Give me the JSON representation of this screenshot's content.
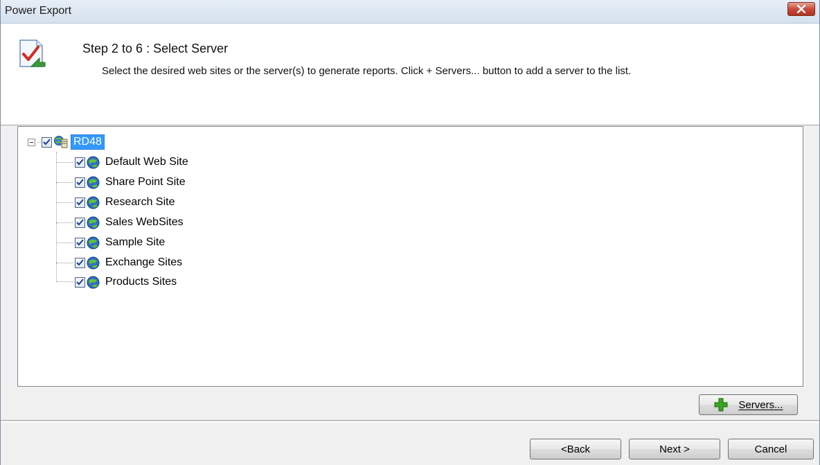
{
  "window": {
    "title": "Power Export"
  },
  "header": {
    "step_title": "Step 2 to 6 : Select Server",
    "description": "Select the desired web sites or the server(s) to generate reports. Click + Servers... button to add a server to the list.",
    "icon": "report-check-icon"
  },
  "tree": {
    "server": {
      "label": "RD48",
      "checked": true,
      "expanded": true
    },
    "sites": [
      {
        "label": "Default Web Site",
        "checked": true
      },
      {
        "label": "Share Point Site",
        "checked": true
      },
      {
        "label": "Research Site",
        "checked": true
      },
      {
        "label": "Sales WebSites",
        "checked": true
      },
      {
        "label": "Sample Site",
        "checked": true
      },
      {
        "label": "Exchange Sites",
        "checked": true
      },
      {
        "label": "Products Sites",
        "checked": true
      }
    ]
  },
  "buttons": {
    "servers": "Servers...",
    "back": "<Back",
    "next": "Next >",
    "cancel": "Cancel"
  },
  "colors": {
    "selection": "#3399ff",
    "close": "#c9493a",
    "add": "#3aa51f"
  }
}
